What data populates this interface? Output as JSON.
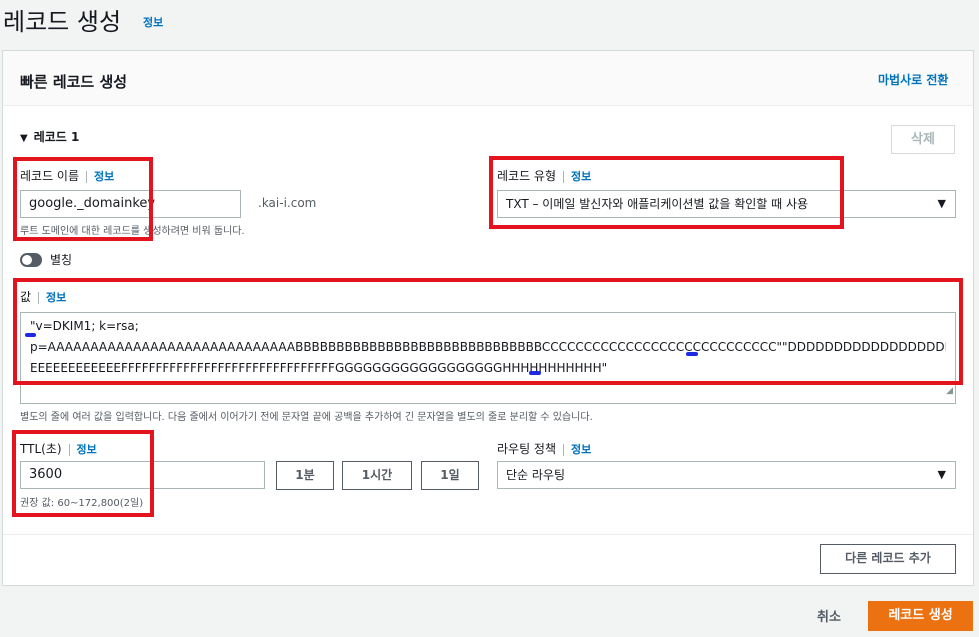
{
  "page": {
    "title": "레코드 생성",
    "info": "정보"
  },
  "panel": {
    "title": "빠른 레코드 생성",
    "wizard_link": "마법사로 전환"
  },
  "record": {
    "header": "레코드 1",
    "delete_label": "삭제",
    "name": {
      "label": "레코드 이름",
      "info": "정보",
      "value": "google._domainkey",
      "suffix": ".kai-i.com",
      "hint": "루트 도메인에 대한 레코드를 생성하려면 비워 둡니다."
    },
    "type": {
      "label": "레코드 유형",
      "info": "정보",
      "selected": "TXT – 이메일 발신자와 애플리케이션별 값을 확인할 때 사용"
    },
    "alias": {
      "label": "별칭"
    },
    "value": {
      "label": "값",
      "info": "정보",
      "lines": [
        "\"v=DKIM1; k=rsa;",
        "p=AAAAAAAAAAAAAAAAAAAAAAAAAAAAABBBBBBBBBBBBBBBBBBBBBBBBBBBBBBCCCCCCCCCCCCCCCCCCCCCCCCCCCC\"\"DDDDDDDDDDDDDDDDDDDDDEEEEEEEEEEEE",
        "EEEEEEEEEEEEFFFFFFFFFFFFFFFFFFFFFFFFFFFFFFFGGGGGGGGGGGGGGGGGGHHHHHHHHHHH\""
      ],
      "hint": "별도의 줄에 여러 값을 입력합니다. 다음 줄에서 이어가기 전에 문자열 끝에 공백을 추가하여 긴 문자열을 별도의 줄로 분리할 수 있습니다."
    },
    "ttl": {
      "label": "TTL(초)",
      "info": "정보",
      "value": "3600",
      "buttons": [
        "1분",
        "1시간",
        "1일"
      ],
      "hint": "권장 값: 60~172,800(2일)"
    },
    "routing": {
      "label": "라우팅 정책",
      "info": "정보",
      "selected": "단순 라우팅"
    }
  },
  "add_record_label": "다른 레코드 추가",
  "footer": {
    "cancel": "취소",
    "create": "레코드 생성"
  },
  "colors": {
    "accent": "#0073bb",
    "primary": "#ec7211",
    "highlight": "#e3141e",
    "spell_marker": "#1d2be0"
  },
  "icons": {
    "caret": "caret-down-icon",
    "select": "dropdown-arrow-icon"
  }
}
